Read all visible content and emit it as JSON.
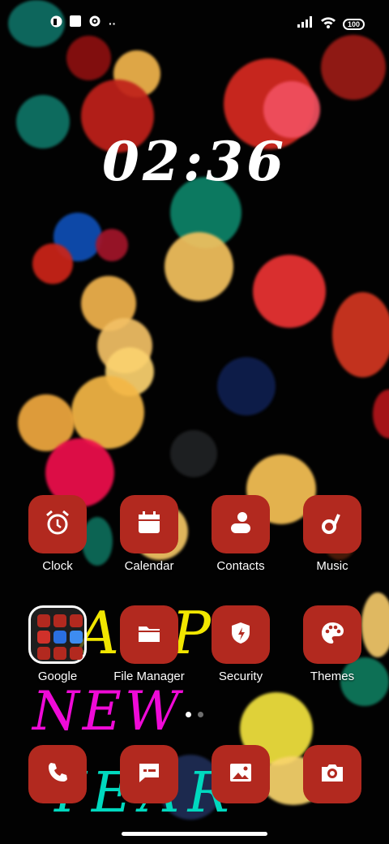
{
  "status_bar": {
    "left_icons": [
      "app-notification-icon",
      "square-notification-icon",
      "gear-icon",
      "more-icon"
    ],
    "right_icons": [
      "signal-icon",
      "wifi-icon",
      "battery-icon"
    ],
    "battery_level": "100",
    "more_text": "··"
  },
  "clock": {
    "time": "02:36"
  },
  "wallpaper": {
    "greeting_line_1": "APP",
    "greeting_line_2": "NEW",
    "greeting_line_3": "YEAR",
    "colors": [
      "#f1e600",
      "#ef0ad7",
      "#00d9bf"
    ]
  },
  "apps": {
    "row1": [
      {
        "label": "Clock",
        "icon": "alarm-clock-icon"
      },
      {
        "label": "Calendar",
        "icon": "calendar-icon"
      },
      {
        "label": "Contacts",
        "icon": "contacts-icon"
      },
      {
        "label": "Music",
        "icon": "music-note-icon"
      }
    ],
    "row2": [
      {
        "label": "Google",
        "icon": "folder-icon"
      },
      {
        "label": "File Manager",
        "icon": "file-folder-icon"
      },
      {
        "label": "Security",
        "icon": "security-shield-icon"
      },
      {
        "label": "Themes",
        "icon": "palette-icon"
      }
    ]
  },
  "dock": [
    {
      "icon": "phone-icon"
    },
    {
      "icon": "messages-icon"
    },
    {
      "icon": "gallery-icon"
    },
    {
      "icon": "camera-icon"
    }
  ],
  "pages": {
    "count": 2,
    "active": 1
  },
  "theme": {
    "tile_color": "#b2291f",
    "accent": "#ffffff"
  }
}
